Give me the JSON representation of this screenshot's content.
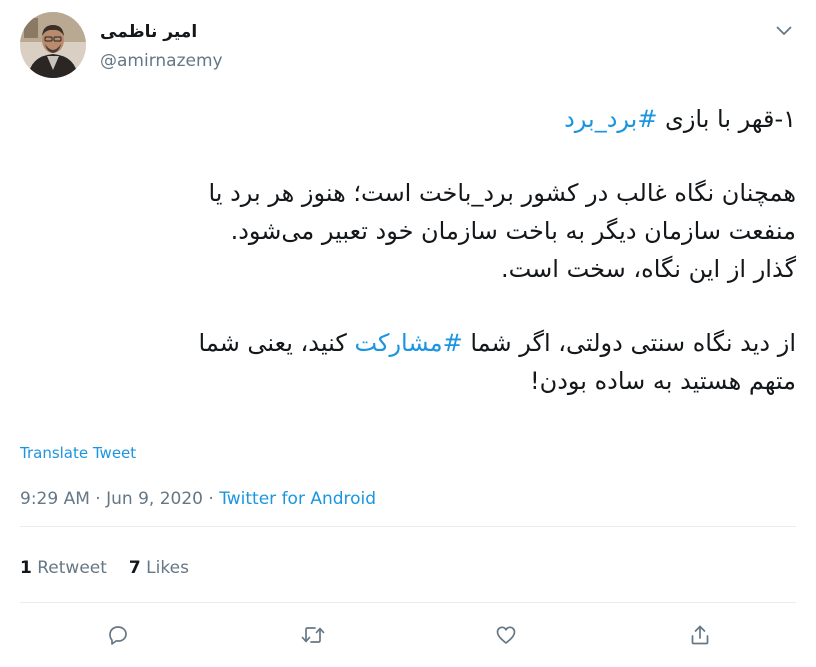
{
  "author": {
    "name": "امیر ناظمی",
    "handle": "@amirnazemy"
  },
  "tweet": {
    "line1_prefix": "۱-قهر با بازی ",
    "line1_hashtag": "#برد_برد",
    "para2": [
      "همچنان نگاه غالب در کشور برد_باخت است؛ هنوز هر برد یا",
      "منفعت سازمان دیگر به باخت سازمان خود تعبیر می‌شود.",
      "گذار از این نگاه، سخت است."
    ],
    "para3_before": "از دید نگاه سنتی دولتی، اگر شما ",
    "para3_hashtag": "#مشارکت",
    "para3_after": " کنید، یعنی شما",
    "para3_line2": "متهم هستید به ساده بودن!"
  },
  "translate_label": "Translate Tweet",
  "meta": {
    "time": "9:29 AM",
    "sep1": " · ",
    "date": "Jun 9, 2020",
    "sep2": " · ",
    "source": "Twitter for Android"
  },
  "stats": {
    "retweets_count": "1",
    "retweets_label": "Retweet",
    "likes_count": "7",
    "likes_label": "Likes"
  },
  "icons": {
    "menu": "chevron-down-icon",
    "reply": "reply-icon",
    "retweet": "retweet-icon",
    "like": "heart-icon",
    "share": "share-icon"
  },
  "colors": {
    "accent": "#1b95e0",
    "secondary_text": "#657786",
    "divider": "#e6ecf0"
  }
}
